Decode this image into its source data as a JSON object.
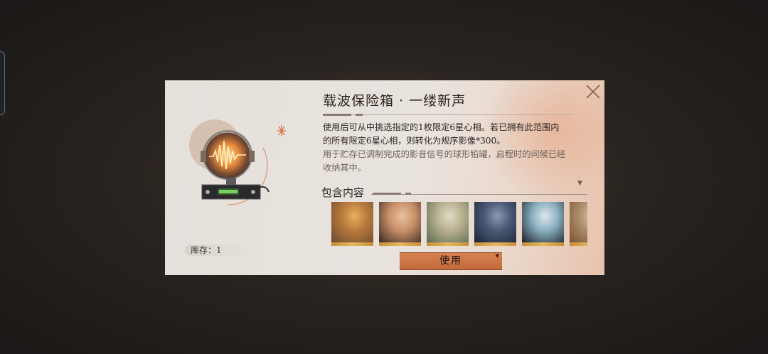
{
  "dialog": {
    "title": "载波保险箱 · 一缕新声",
    "description_1": "使用后可从中挑选指定的1枚限定6星心相。若已拥有此范围内",
    "description_2": "的所有限定6星心相，则转化为规序影像*300。",
    "lore_1": "用于贮存已调制完成的影音信号的球形铅罐，启程时的问候已经",
    "lore_2": "收纳其中。",
    "stock_label": "库存：1",
    "contains_label": "包含内容",
    "use_button": "使用",
    "close_icon": "close-icon",
    "item_icon": "radio-globe-icon",
    "scroll_indicator": "▼",
    "cards": [
      {
        "name": "card-1",
        "palette": [
          "#6b4a30",
          "#b87a3c",
          "#e8b060"
        ]
      },
      {
        "name": "card-2",
        "palette": [
          "#3a2620",
          "#c9906a",
          "#e8c0a0"
        ]
      },
      {
        "name": "card-3",
        "palette": [
          "#5a6a50",
          "#b8b090",
          "#e0dcc8"
        ]
      },
      {
        "name": "card-4",
        "palette": [
          "#1e2430",
          "#4a5a78",
          "#8a9ab0"
        ]
      },
      {
        "name": "card-5",
        "palette": [
          "#1a2028",
          "#8ab0c0",
          "#e0e8ec"
        ]
      },
      {
        "name": "card-6",
        "palette": [
          "#7a5030",
          "#b09070",
          "#e0c8a0"
        ]
      }
    ]
  },
  "colors": {
    "accent": "#c97a48",
    "panel": "#e8e2dd",
    "text": "#2b2420",
    "muted": "#6c625b",
    "gold_band": "#e6b861"
  }
}
